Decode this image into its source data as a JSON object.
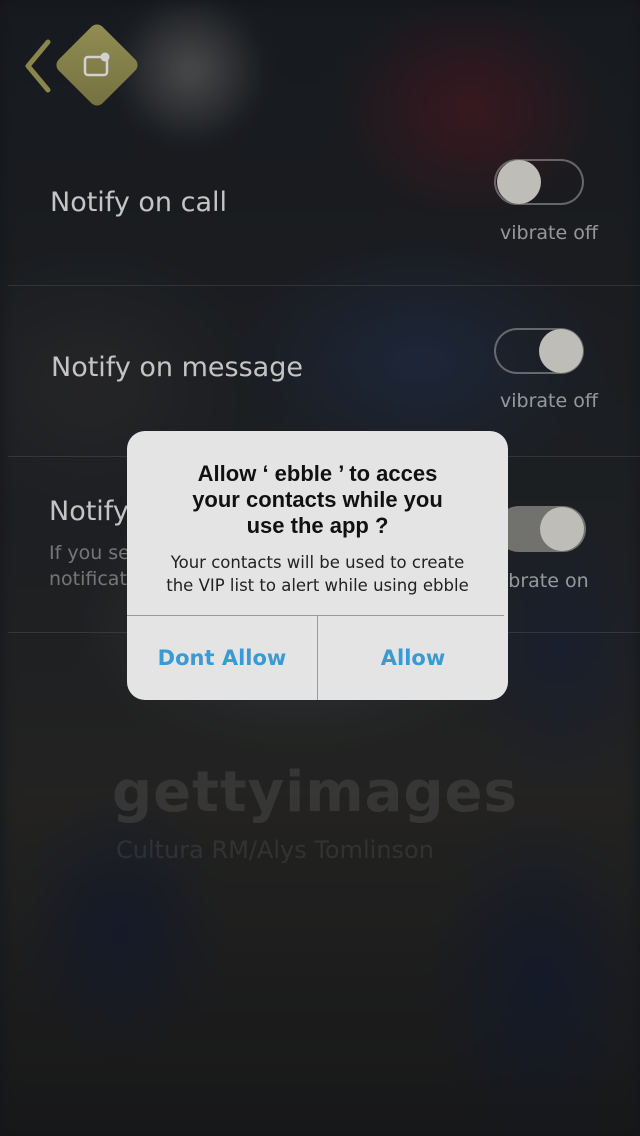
{
  "header": {
    "back_icon": "chevron-left-icon",
    "app_icon": "message-bubble-icon",
    "accent_color": "#a9a35f"
  },
  "settings": {
    "rows": [
      {
        "label": "Notify on call",
        "vibrate_label": "vibrate off",
        "toggle_state": "off"
      },
      {
        "label": "Notify on message",
        "vibrate_label": "vibrate off",
        "toggle_state": "on"
      },
      {
        "label": "Notify",
        "subtitle_line1": "If you se",
        "subtitle_line2": "notificat",
        "vibrate_label": "ibrate on",
        "toggle_state": "on"
      }
    ]
  },
  "watermark": {
    "brand": "gettyimages",
    "credit": "Cultura RM/Alys Tomlinson"
  },
  "alert": {
    "title_line1": "Allow ‘ ebble ’ to acces",
    "title_line2": "your contacts while you",
    "title_line3": "use the app ?",
    "message_line1": "Your contacts will be used to create",
    "message_line2": "the VIP list to alert while using ebble",
    "dont_allow_label": "Dont Allow",
    "allow_label": "Allow",
    "button_color": "#3a9ad4"
  }
}
